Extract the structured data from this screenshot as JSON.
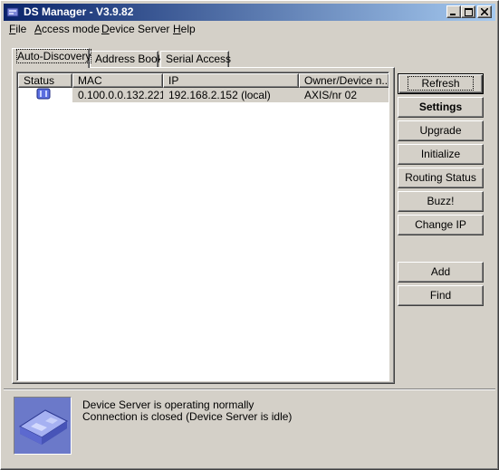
{
  "window": {
    "title": "DS Manager - V3.9.82",
    "controls": [
      "minimize",
      "maximize",
      "close"
    ]
  },
  "menu": [
    {
      "label": "File",
      "mnemonic": "F"
    },
    {
      "label": "Access mode",
      "mnemonic": "A"
    },
    {
      "label": "Device Server",
      "mnemonic": "D"
    },
    {
      "label": "Help",
      "mnemonic": "H"
    }
  ],
  "tabs": [
    {
      "label": "Auto-Discovery",
      "active": true
    },
    {
      "label": "Address Book",
      "active": false
    },
    {
      "label": "Serial Access",
      "active": false
    }
  ],
  "table": {
    "columns": [
      "Status",
      "MAC",
      "IP",
      "Owner/Device n..."
    ],
    "rows": [
      {
        "status_icon": "device-ok-icon",
        "mac": "0.100.0.0.132.221",
        "ip": "192.168.2.152 (local)",
        "owner": "AXIS/nr 02"
      }
    ]
  },
  "buttons": {
    "refresh": "Refresh",
    "settings": "Settings",
    "upgrade": "Upgrade",
    "initialize": "Initialize",
    "routing_status": "Routing Status",
    "buzz": "Buzz!",
    "change_ip": "Change IP",
    "add": "Add",
    "find": "Find"
  },
  "status": {
    "line1": "Device Server is operating normally",
    "line2": "Connection is closed (Device Server is idle)",
    "icon": "device-server-icon"
  },
  "colors": {
    "titlebar_start": "#0a246a",
    "titlebar_end": "#a6caf0",
    "face": "#d4d0c8",
    "device_icon": "#6b79c9"
  }
}
